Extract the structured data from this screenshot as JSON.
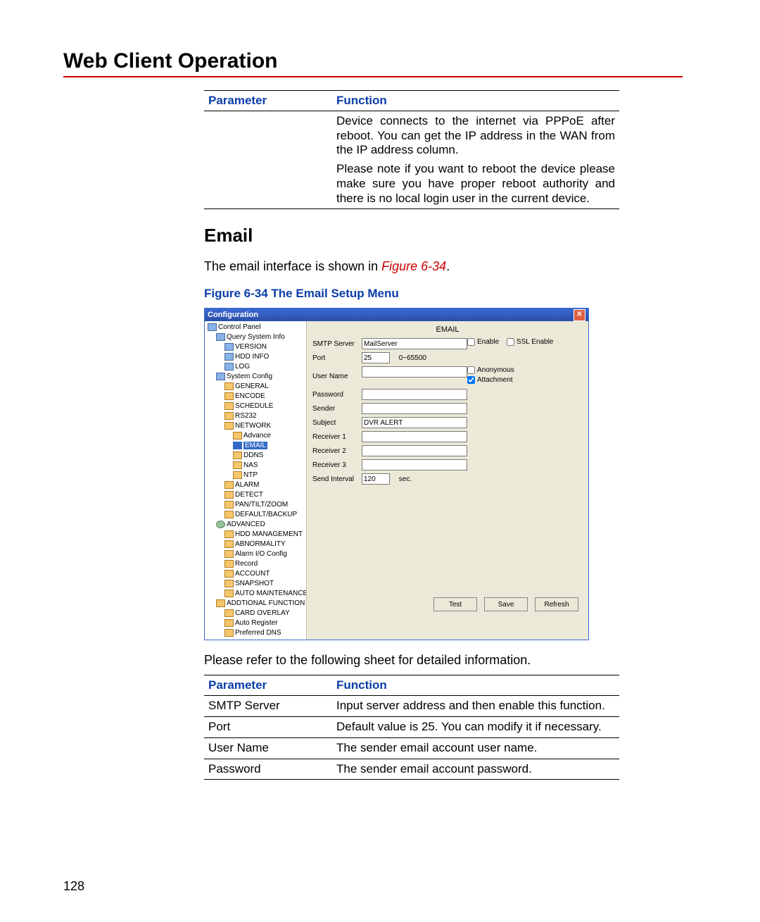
{
  "heading": "Web Client Operation",
  "table1": {
    "head": [
      "Parameter",
      "Function"
    ],
    "row": {
      "param": "",
      "para1": "Device connects to the internet via PPPoE after reboot. You can get the IP address in the WAN from the IP address column.",
      "para2": "Please note if you want to reboot the device please make sure you have proper reboot authority and there is no local login user in the current device."
    }
  },
  "email": {
    "title": "Email",
    "intro_pre": "The email interface is shown in ",
    "intro_ref": "Figure 6-34",
    "intro_post": ".",
    "caption": "Figure 6-34 The Email Setup Menu",
    "postfig": "Please refer to the following sheet for detailed information."
  },
  "table2": {
    "head": [
      "Parameter",
      "Function"
    ],
    "rows": [
      {
        "p": "SMTP Server",
        "f": "Input server address and then enable this function."
      },
      {
        "p": "Port",
        "f": "Default value is 25. You can modify it if necessary."
      },
      {
        "p": "User Name",
        "f": "The sender email account user name."
      },
      {
        "p": "Password",
        "f": "The sender email account password."
      }
    ]
  },
  "shot": {
    "title": "Configuration",
    "close": "✕",
    "panel_title": "EMAIL",
    "tree": {
      "root": "Control Panel",
      "qsi": "Query System Info",
      "qsi_children": [
        "VERSION",
        "HDD INFO",
        "LOG"
      ],
      "sys": "System Config",
      "sys_children": [
        "GENERAL",
        "ENCODE",
        "SCHEDULE",
        "RS232"
      ],
      "net": "NETWORK",
      "net_children": [
        "Advance",
        "EMAIL",
        "DDNS",
        "NAS",
        "NTP"
      ],
      "sys_children2": [
        "ALARM",
        "DETECT",
        "PAN/TILT/ZOOM",
        "DEFAULT/BACKUP"
      ],
      "adv": "ADVANCED",
      "adv_children": [
        "HDD MANAGEMENT",
        "ABNORMALITY",
        "Alarm I/O Config",
        "Record",
        "ACCOUNT",
        "SNAPSHOT",
        "AUTO MAINTENANCE"
      ],
      "add": "ADDTIONAL FUNCTION",
      "add_children": [
        "CARD OVERLAY",
        "Auto Register",
        "Preferred DNS"
      ]
    },
    "labels": {
      "smtp": "SMTP Server",
      "port": "Port",
      "user": "User Name",
      "pass": "Password",
      "sender": "Sender",
      "subject": "Subject",
      "r1": "Receiver 1",
      "r2": "Receiver 2",
      "r3": "Receiver 3",
      "interval": "Send Interval",
      "sec": "sec.",
      "enable": "Enable",
      "ssl": "SSL Enable",
      "anon": "Anonymous",
      "att": "Attachment"
    },
    "values": {
      "smtp": "MailServer",
      "port": "25",
      "port_range": "0~65500",
      "subject": "DVR ALERT",
      "interval": "120"
    },
    "buttons": {
      "test": "Test",
      "save": "Save",
      "refresh": "Refresh"
    }
  },
  "page_number": "128"
}
